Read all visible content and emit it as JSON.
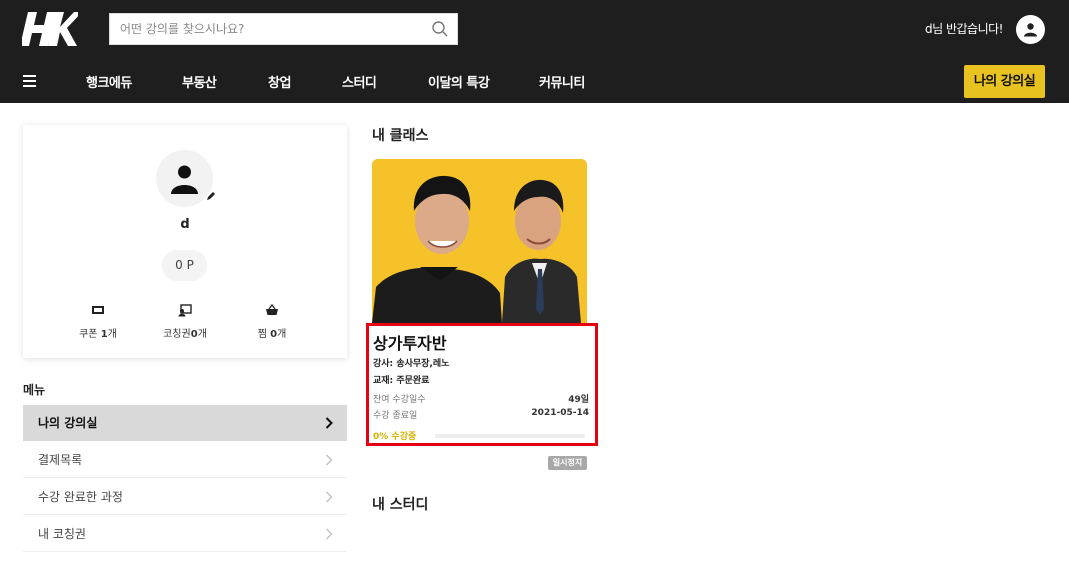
{
  "header": {
    "logo_text": "HK",
    "search_placeholder": "어떤 강의를 찾으시나요?",
    "greeting": "d님 반갑습니다!",
    "nav": [
      "행크에듀",
      "부동산",
      "창업",
      "스터디",
      "이달의 특강",
      "커뮤니티"
    ],
    "my_classroom_button": "나의 강의실"
  },
  "profile": {
    "name": "d",
    "points": "0 P",
    "stats": [
      {
        "label": "쿠폰",
        "count": "1",
        "unit": "개",
        "icon": "coupon-icon"
      },
      {
        "label": "코칭권",
        "count": "0",
        "unit": "개",
        "icon": "coaching-icon"
      },
      {
        "label": "찜",
        "count": "0",
        "unit": "개",
        "icon": "basket-icon"
      }
    ]
  },
  "menu": {
    "title": "메뉴",
    "items": [
      "나의 강의실",
      "결제목록",
      "수강 완료한 과정",
      "내 코칭권"
    ]
  },
  "main": {
    "my_class_title": "내 클래스",
    "my_study_title": "내 스터디",
    "course": {
      "title": "상가투자반",
      "instructor_label": "강사:",
      "instructor": "송사무장,레노",
      "textbook_label": "교재:",
      "textbook": "주문완료",
      "remaining_label": "잔여 수강일수",
      "remaining_value": "49일",
      "end_label": "수강 종료일",
      "end_value": "2021-05-14",
      "progress_text": "0% 수강중",
      "progress_percent": 0,
      "status_badge": "일시정지"
    }
  },
  "colors": {
    "header_bg": "#1e1e1e",
    "accent_yellow": "#e8c320",
    "highlight_red": "#e50012",
    "menu_active_bg": "#d9d9d9"
  }
}
